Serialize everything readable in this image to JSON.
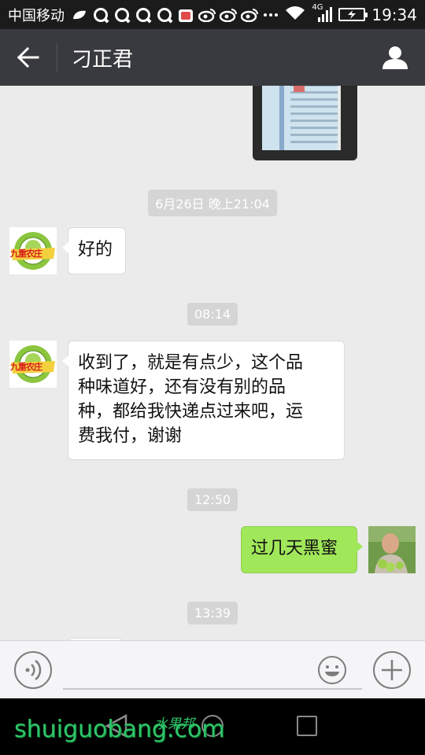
{
  "status_bar": {
    "carrier": "中国移动",
    "network": "4G",
    "time": "19:34",
    "icons": [
      "leaf-icon",
      "qq-icon",
      "qq-icon",
      "qq-icon",
      "qq-icon",
      "app-store-icon",
      "weibo-icon",
      "weibo-icon",
      "weibo-icon",
      "more-icon",
      "wifi-icon",
      "signal-icon",
      "battery-charging-icon"
    ]
  },
  "header": {
    "title": "刁正君",
    "back_icon": "back-arrow-icon",
    "profile_icon": "person-icon"
  },
  "messages": [
    {
      "type": "image",
      "side": "right",
      "description_icon": "photo-thumbnail"
    },
    {
      "type": "time",
      "text": "6月26日 晚上21:04"
    },
    {
      "type": "text",
      "side": "left",
      "text": "好的"
    },
    {
      "type": "time",
      "text": "08:14"
    },
    {
      "type": "text",
      "side": "left",
      "lines": [
        "收到了，就是有点少，这个品",
        "种味道好，还有没有别的品",
        "种，都给我快递点过来吧，运",
        "费我付，谢谢"
      ]
    },
    {
      "type": "time",
      "text": "12:50"
    },
    {
      "type": "text",
      "side": "right",
      "text": "过几天黑蜜"
    },
    {
      "type": "time",
      "text": "13:39"
    }
  ],
  "contact_avatar_text": "九重农庄",
  "input_bar": {
    "placeholder": "",
    "voice_icon": "voice-icon",
    "emoji_icon": "emoji-icon",
    "plus_icon": "plus-icon"
  },
  "watermark": {
    "text": "shuiguobang.com",
    "text_cn": "水果邦"
  },
  "colors": {
    "title_bar": "#393a3f",
    "chat_bg": "#ebebeb",
    "bubble_self": "#a0e75a",
    "bubble_other": "#ffffff",
    "watermark": "#2fc46a"
  }
}
